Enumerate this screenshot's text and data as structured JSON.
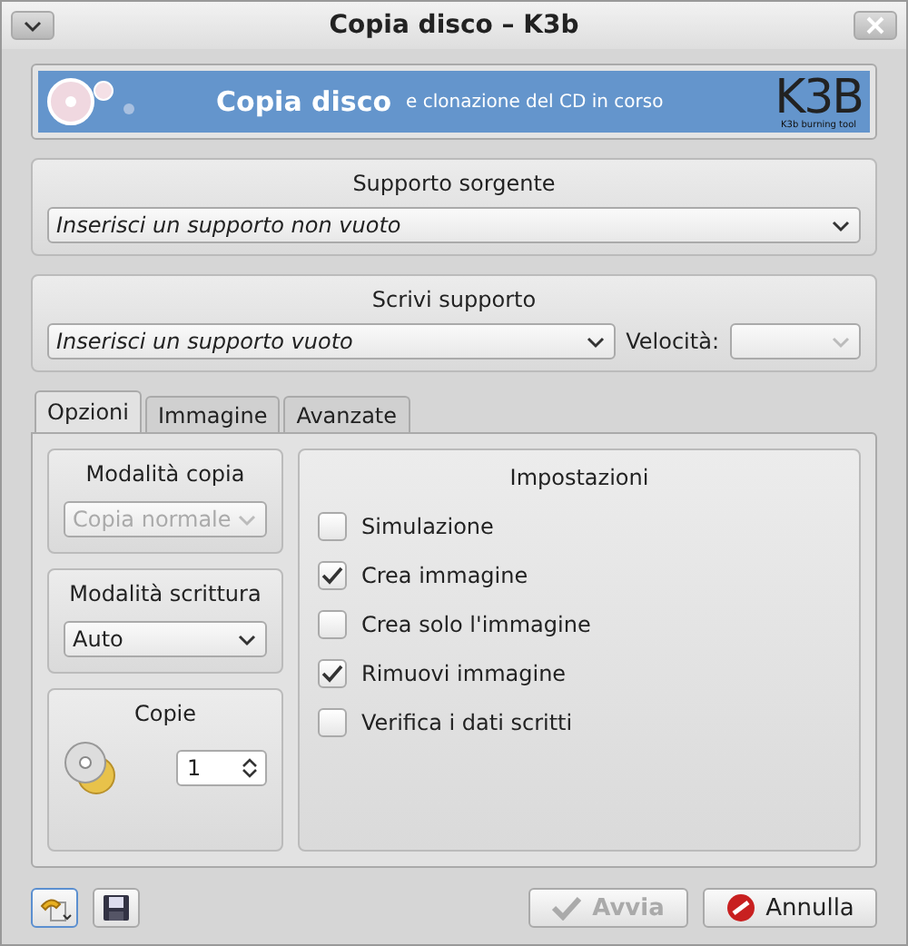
{
  "window": {
    "title": "Copia disco – K3b"
  },
  "banner": {
    "title": "Copia disco",
    "subtitle": "e clonazione del CD in corso",
    "logo": "K3B",
    "logo_caption": "K3b burning tool"
  },
  "source": {
    "title": "Supporto sorgente",
    "value": "Inserisci un supporto non vuoto"
  },
  "target": {
    "title": "Scrivi supporto",
    "value": "Inserisci un supporto vuoto",
    "speed_label": "Velocità:",
    "speed_disabled": true
  },
  "tabs": [
    {
      "label": "Opzioni",
      "selected": true
    },
    {
      "label": "Immagine",
      "selected": false
    },
    {
      "label": "Avanzate",
      "selected": false
    }
  ],
  "copy_mode": {
    "title": "Modalità copia",
    "value": "Copia normale",
    "disabled": true
  },
  "write_mode": {
    "title": "Modalità scrittura",
    "value": "Auto",
    "disabled": false
  },
  "copies": {
    "title": "Copie",
    "value": "1"
  },
  "settings": {
    "title": "Impostazioni",
    "options": [
      {
        "label": "Simulazione",
        "checked": false
      },
      {
        "label": "Crea immagine",
        "checked": true
      },
      {
        "label": "Crea solo l'immagine",
        "checked": false
      },
      {
        "label": "Rimuovi immagine",
        "checked": true
      },
      {
        "label": "Verifica i dati scritti",
        "checked": false
      }
    ]
  },
  "buttons": [
    {
      "kind": "start",
      "label": "Avvia",
      "disabled": true
    },
    {
      "kind": "cancel",
      "label": "Annulla",
      "disabled": false
    }
  ]
}
